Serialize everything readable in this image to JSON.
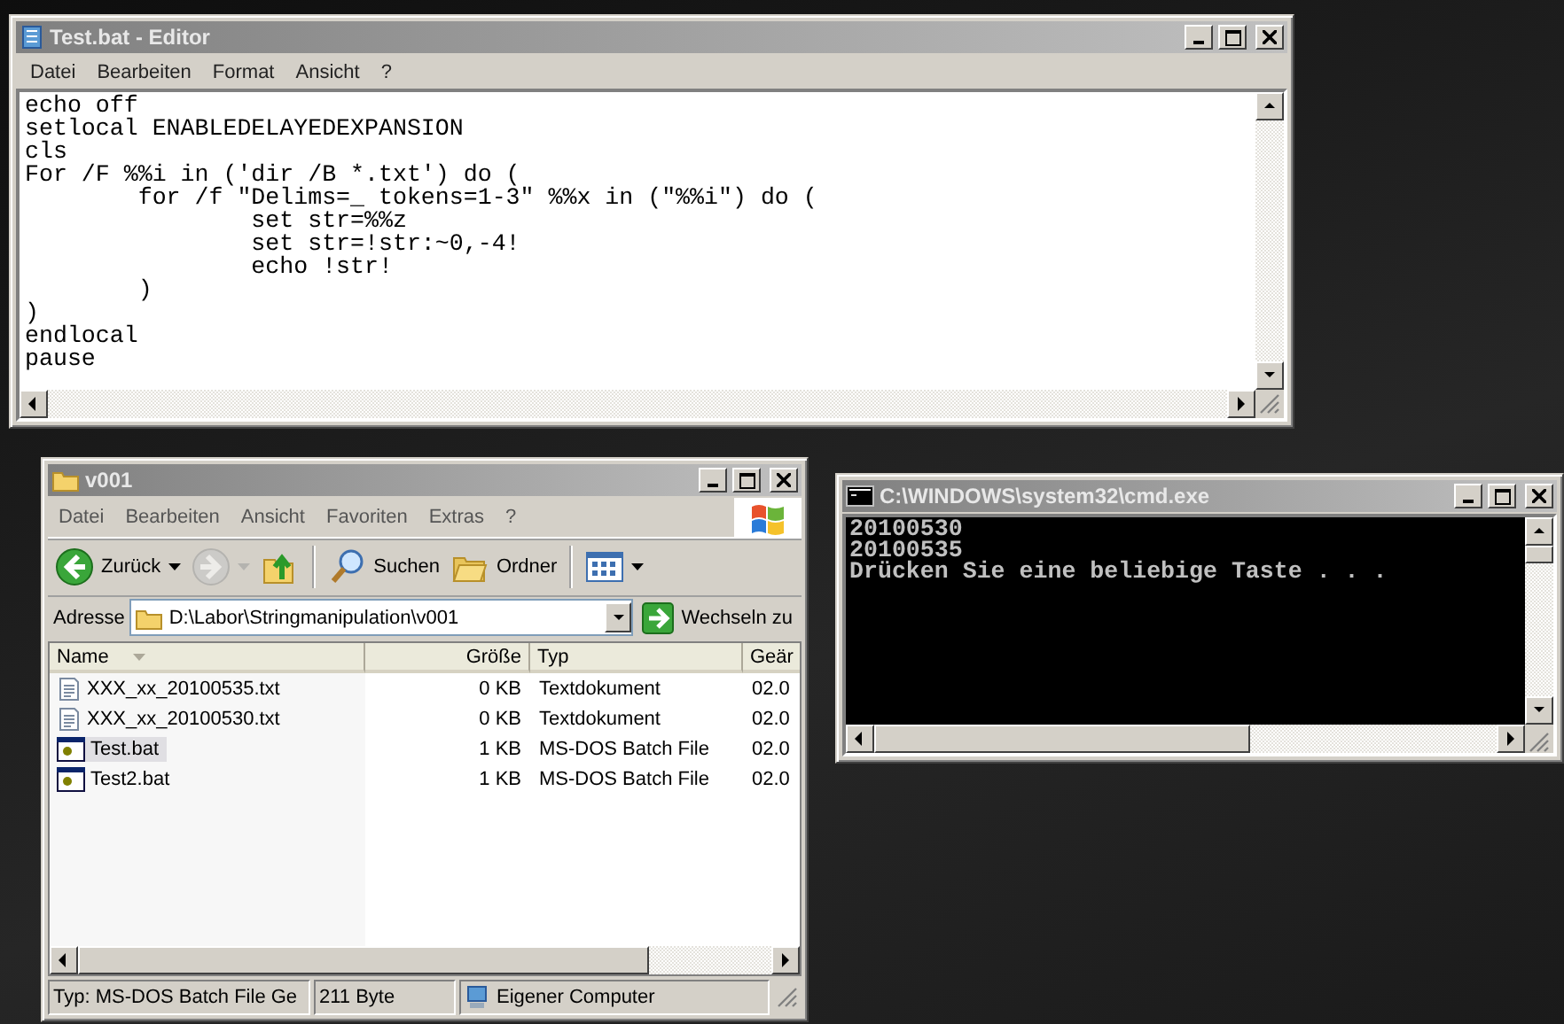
{
  "editor": {
    "title": "Test.bat - Editor",
    "menu": [
      "Datei",
      "Bearbeiten",
      "Format",
      "Ansicht",
      "?"
    ],
    "lines": [
      "echo off",
      "setlocal ENABLEDELAYEDEXPANSION",
      "cls",
      "For /F %%i in ('dir /B *.txt') do (",
      "\tfor /f \"Delims=_ tokens=1-3\" %%x in (\"%%i\") do (",
      "\t\tset str=%%z",
      "\t\tset str=!str:~0,-4!",
      "\t\techo !str!",
      "\t)",
      ")",
      "endlocal",
      "pause"
    ]
  },
  "explorer": {
    "title": "v001",
    "menu": [
      "Datei",
      "Bearbeiten",
      "Ansicht",
      "Favoriten",
      "Extras",
      "?"
    ],
    "toolbar": [
      {
        "kind": "back",
        "label": "Zurück",
        "disabled": false
      },
      {
        "kind": "forward",
        "disabled": true
      },
      {
        "kind": "up",
        "disabled": false
      },
      {
        "kind": "search",
        "label": "Suchen",
        "disabled": false
      },
      {
        "kind": "folders",
        "label": "Ordner",
        "disabled": false
      },
      {
        "kind": "views",
        "disabled": false
      }
    ],
    "address": {
      "label": "Adresse",
      "value": "D:\\Labor\\Stringmanipulation\\v001",
      "go": "Wechseln zu"
    },
    "columns": [
      "Name",
      "Größe",
      "Typ",
      "Geär"
    ],
    "rows": [
      {
        "kind": "text",
        "name": "XXX_xx_20100535.txt",
        "size": "0 KB",
        "type": "Textdokument",
        "modified": "02.0",
        "selected": false
      },
      {
        "kind": "text",
        "name": "XXX_xx_20100530.txt",
        "size": "0 KB",
        "type": "Textdokument",
        "modified": "02.0",
        "selected": false
      },
      {
        "kind": "batch",
        "name": "Test.bat",
        "size": "1 KB",
        "type": "MS-DOS Batch File",
        "modified": "02.0",
        "selected": true
      },
      {
        "kind": "batch",
        "name": "Test2.bat",
        "size": "1 KB",
        "type": "MS-DOS Batch File",
        "modified": "02.0",
        "selected": false
      }
    ],
    "status_bar": [
      "Typ: MS-DOS Batch File Ge",
      "211 Byte",
      "Eigener Computer"
    ]
  },
  "console": {
    "title": "C:\\WINDOWS\\system32\\cmd.exe",
    "lines": [
      "20100530",
      "20100535",
      "Drücken Sie eine beliebige Taste . . ."
    ]
  }
}
